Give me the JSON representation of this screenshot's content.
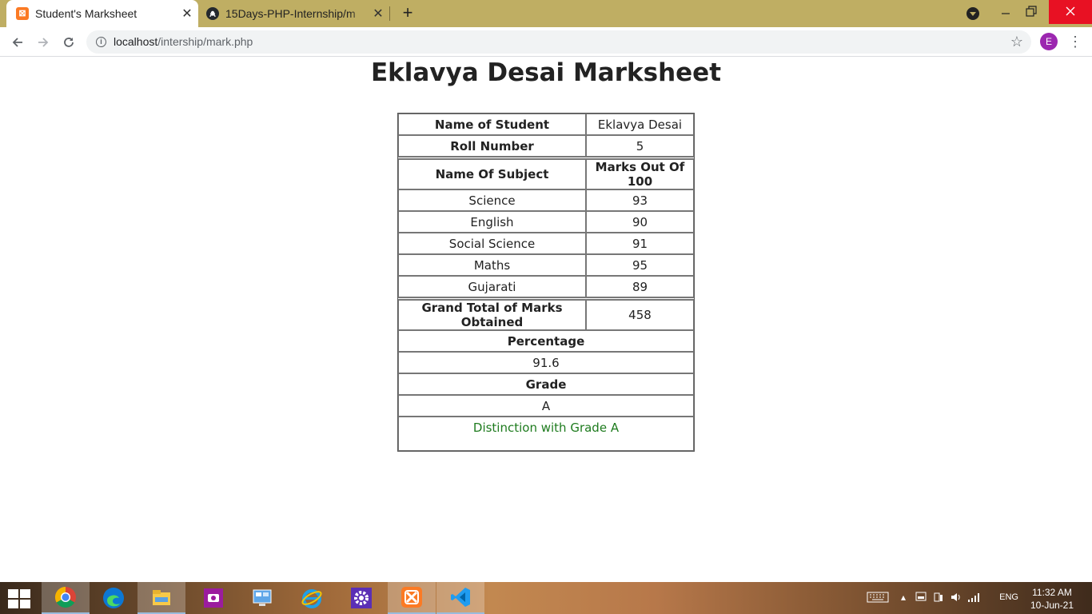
{
  "browser": {
    "tabs": [
      {
        "title": "Student's Marksheet",
        "active": true,
        "favicon": "xampp-icon"
      },
      {
        "title": "15Days-PHP-Internship/m",
        "active": false,
        "favicon": "github-icon"
      }
    ],
    "close_glyph": "✕",
    "new_tab_glyph": "+",
    "url_host": "localhost",
    "url_path": "/intership/mark.php",
    "profile_initial": "E"
  },
  "page": {
    "title": "Eklavya Desai Marksheet",
    "student": {
      "name_label": "Name of Student",
      "name_value": "Eklavya Desai",
      "roll_label": "Roll Number",
      "roll_value": "5"
    },
    "subjects_header": {
      "subject": "Name Of Subject",
      "marks": "Marks Out Of 100"
    },
    "subjects": [
      {
        "name": "Science",
        "marks": "93"
      },
      {
        "name": "English",
        "marks": "90"
      },
      {
        "name": "Social Science",
        "marks": "91"
      },
      {
        "name": "Maths",
        "marks": "95"
      },
      {
        "name": "Gujarati",
        "marks": "89"
      }
    ],
    "total_label": "Grand Total of Marks Obtained",
    "total_value": "458",
    "percentage_label": "Percentage",
    "percentage_value": "91.6",
    "grade_label": "Grade",
    "grade_value": "A",
    "remark": "Distinction with Grade A",
    "remark_color": "#1e7b1e"
  },
  "taskbar": {
    "apps": [
      "chrome-icon",
      "edge-icon",
      "file-explorer-icon",
      "camera-icon",
      "control-panel-icon",
      "internet-explorer-icon",
      "settings-icon",
      "xampp-icon",
      "vscode-icon"
    ],
    "language": "ENG",
    "time": "11:32 AM",
    "date": "10-Jun-21"
  }
}
